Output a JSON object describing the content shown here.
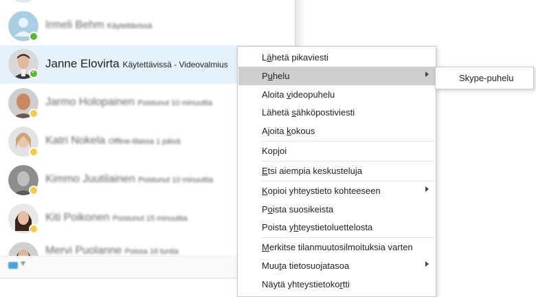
{
  "contacts": [
    {
      "name": "Irmeli Behm",
      "status": "Käytettävissä",
      "presence": "green"
    },
    {
      "name": "Janne Elovirta",
      "status": "Käytettävissä - Videovalmius",
      "presence": "green",
      "selected": true
    },
    {
      "name": "Jarmo Holopainen",
      "status": "Poistunut 10 minuuttia",
      "presence": "yellow"
    },
    {
      "name": "Katri Nokela",
      "status": "Offline-tilassa 1 päivä",
      "presence": "yellow"
    },
    {
      "name": "Kimmo Juutilainen",
      "status": "Poistunut 10 minuuttia",
      "presence": "yellow"
    },
    {
      "name": "Kiti Poikonen",
      "status": "Poistunut 15 minuuttia",
      "presence": "yellow"
    },
    {
      "name": "Mervi Puolanne",
      "status": "Poissa 16 tuntia",
      "presence": "yellow"
    }
  ],
  "menu": {
    "items": [
      {
        "pre": "L",
        "u": "ä",
        "post": "hetä pikaviesti"
      },
      {
        "pre": "P",
        "u": "u",
        "post": "helu",
        "submenu": true,
        "highlighted": true
      },
      {
        "pre": "Aloita ",
        "u": "v",
        "post": "ideopuhelu"
      },
      {
        "pre": "Lähetä ",
        "u": "s",
        "post": "ähköpostiviesti"
      },
      {
        "pre": "Ajoita ",
        "u": "k",
        "post": "okous"
      },
      {
        "pre": "Kop",
        "u": "j",
        "post": "oi"
      },
      {
        "pre": "",
        "u": "E",
        "post": "tsi aiempia keskusteluja"
      },
      {
        "pre": "",
        "u": "K",
        "post": "opioi yhteystieto kohteeseen",
        "submenu": true
      },
      {
        "pre": "P",
        "u": "o",
        "post": "ista suosikeista"
      },
      {
        "pre": "Poista y",
        "u": "h",
        "post": "teystietoluettelosta"
      },
      {
        "pre": "",
        "u": "M",
        "post": "erkitse tilanmuutosilmoituksia varten"
      },
      {
        "pre": "Muu",
        "u": "t",
        "post": "a tietosuojatasoa",
        "submenu": true
      },
      {
        "pre": "Näytä yhteystietoko",
        "u": "r",
        "post": "tti"
      }
    ],
    "submenu_item": "Skype-puhelu"
  },
  "colors": {
    "selected_row": "#e5f1fb",
    "menu_highlight": "#cfcfcf",
    "presence_available": "#5db72f",
    "presence_away": "#f7c948"
  }
}
